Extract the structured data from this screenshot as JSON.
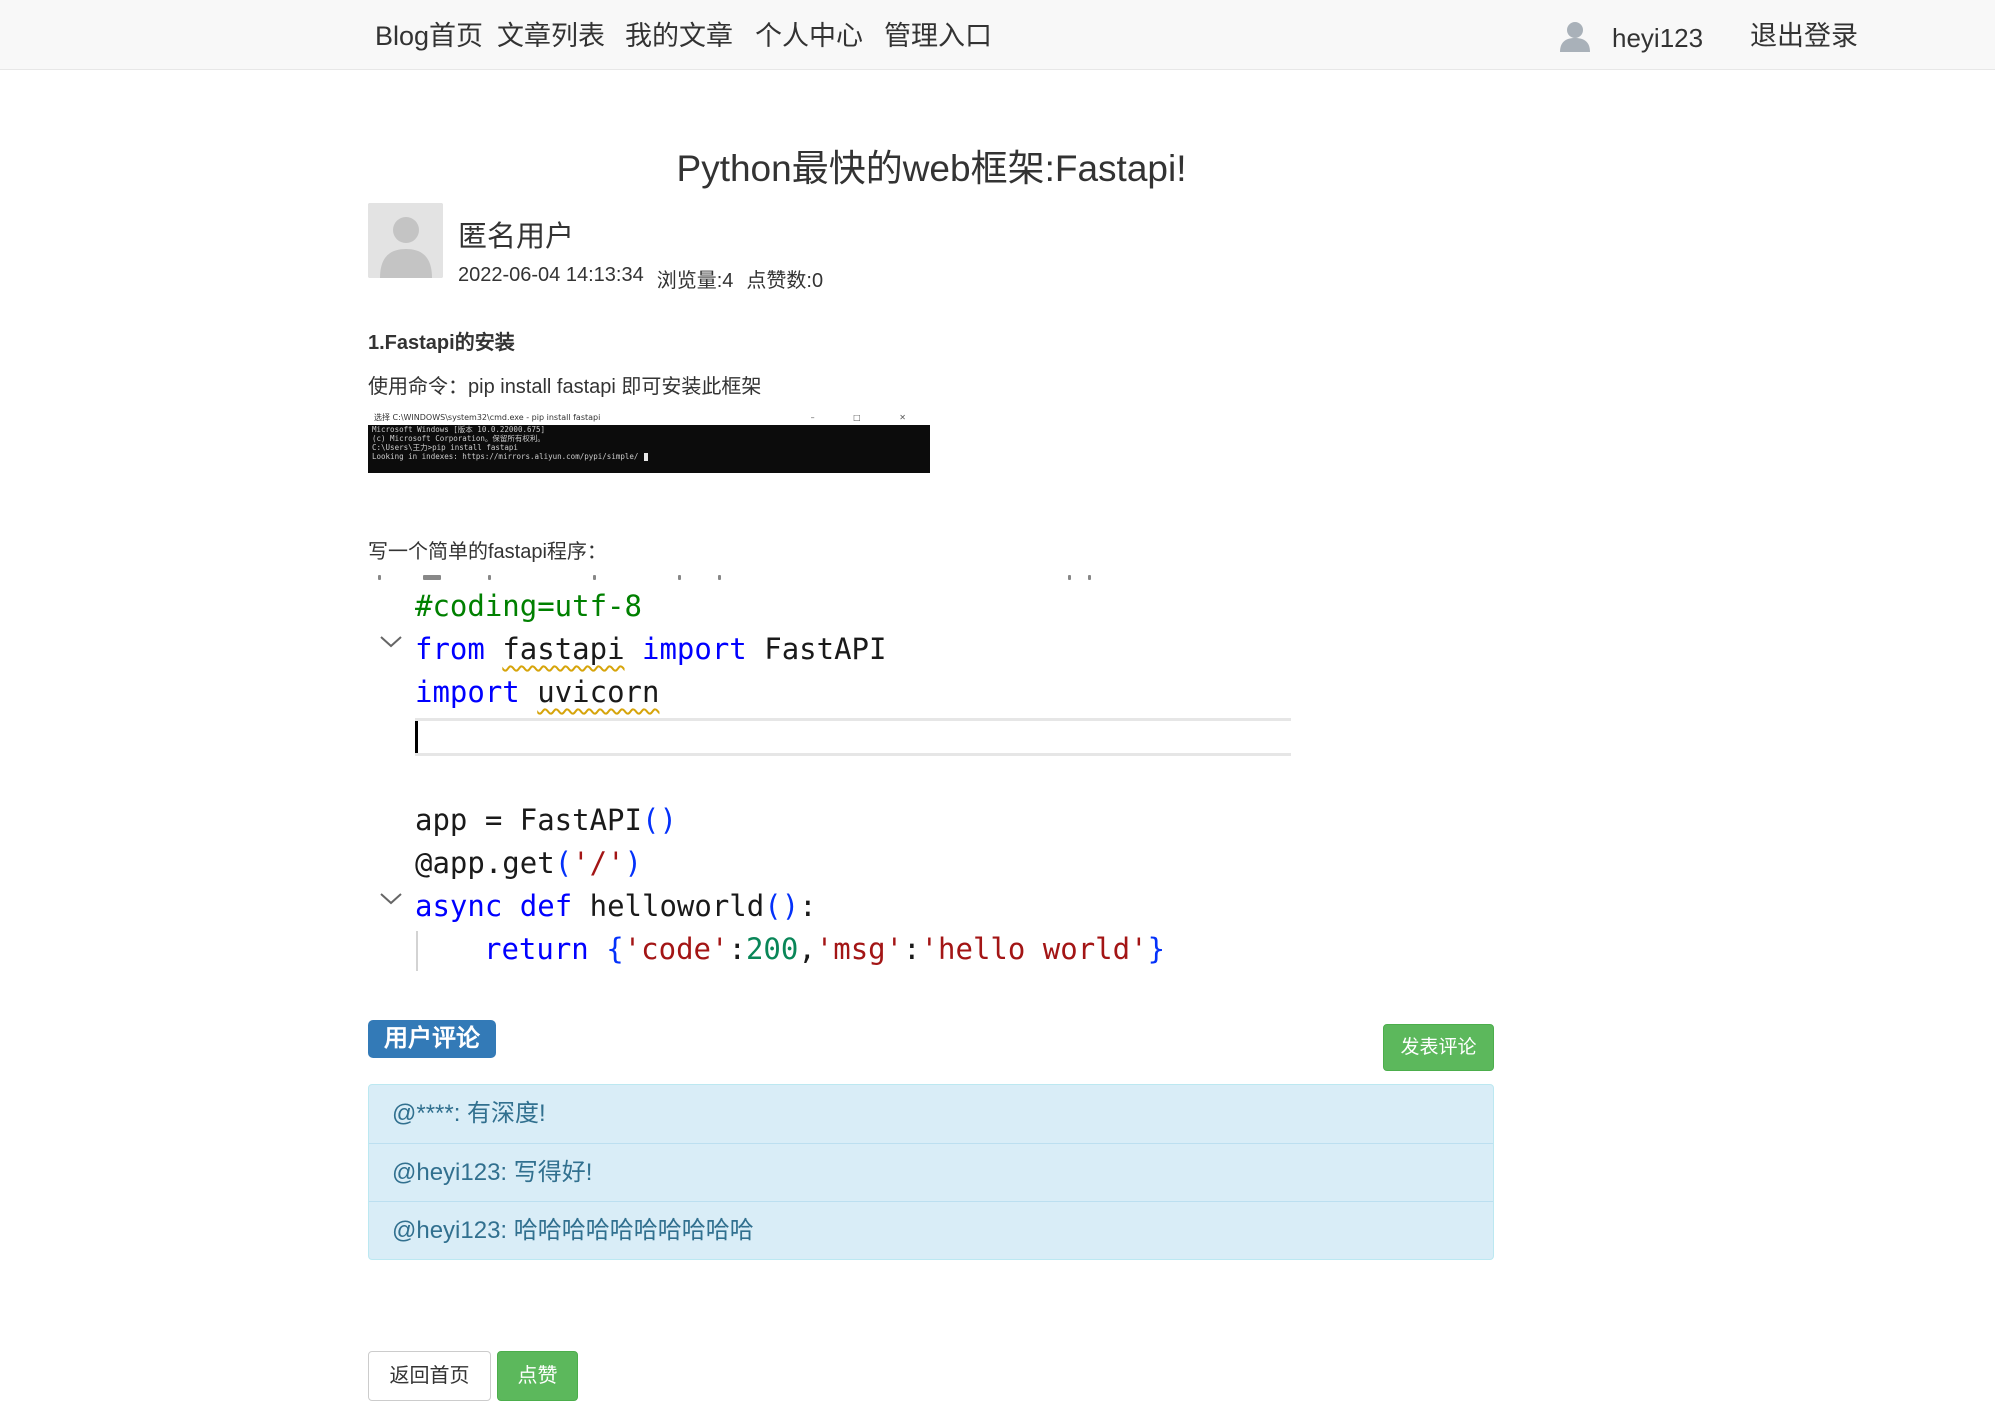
{
  "nav": {
    "items": [
      "Blog首页",
      "文章列表",
      "我的文章",
      "个人中心",
      "管理入口"
    ],
    "username": "heyi123",
    "logout": "退出登录"
  },
  "article": {
    "title": "Python最快的web框架:Fastapi!",
    "author": "匿名用户",
    "datetime": "2022-06-04 14:13:34",
    "views": "浏览量:4",
    "likes": "点赞数:0",
    "section_title": "1.Fastapi的安装",
    "install_text": "使用命令：pip install fastapi 即可安装此框架",
    "program_text": "写一个简单的fastapi程序："
  },
  "terminal": {
    "title": "选择 C:\\WINDOWS\\system32\\cmd.exe - pip  install fastapi",
    "controls": "–  □  ✕",
    "lines": [
      "Microsoft Windows [版本 10.0.22000.675]",
      "(c) Microsoft Corporation。保留所有权利。",
      "",
      "C:\\Users\\王力>pip install fastapi",
      "Looking in indexes: https://mirrors.aliyun.com/pypi/simple/"
    ]
  },
  "code": {
    "l1": "#coding=utf-8",
    "l2_from": "from",
    "l2_mod": "fastapi",
    "l2_import": "import",
    "l2_name": "FastAPI",
    "l3_import": "import",
    "l3_mod": "uvicorn",
    "l5_a": "app = FastAPI",
    "l5_p": "()",
    "l6_a": "@app.get",
    "l6_p1": "(",
    "l6_s": "'/'",
    "l6_p2": ")",
    "l7_async": "async",
    "l7_def": "def",
    "l7_name": " helloworld",
    "l7_p": "()",
    "l7_colon": ":",
    "l8_return": "return",
    "l8_b1": "{",
    "l8_s1": "'code'",
    "l8_c1": ":",
    "l8_n": "200",
    "l8_comma": ",",
    "l8_s2": "'msg'",
    "l8_c2": ":",
    "l8_s3": "'hello world'",
    "l8_b2": "}"
  },
  "comments": {
    "badge": "用户评论",
    "post_button": "发表评论",
    "items": [
      "@****:  有深度!",
      "@heyi123:  写得好!",
      "@heyi123:  哈哈哈哈哈哈哈哈哈哈"
    ]
  },
  "buttons": {
    "back": "返回首页",
    "like": "点赞"
  },
  "colors": {
    "primary": "#337ab7",
    "success": "#5cb85c",
    "info_bg": "#d9edf7",
    "info_text": "#31708f"
  }
}
